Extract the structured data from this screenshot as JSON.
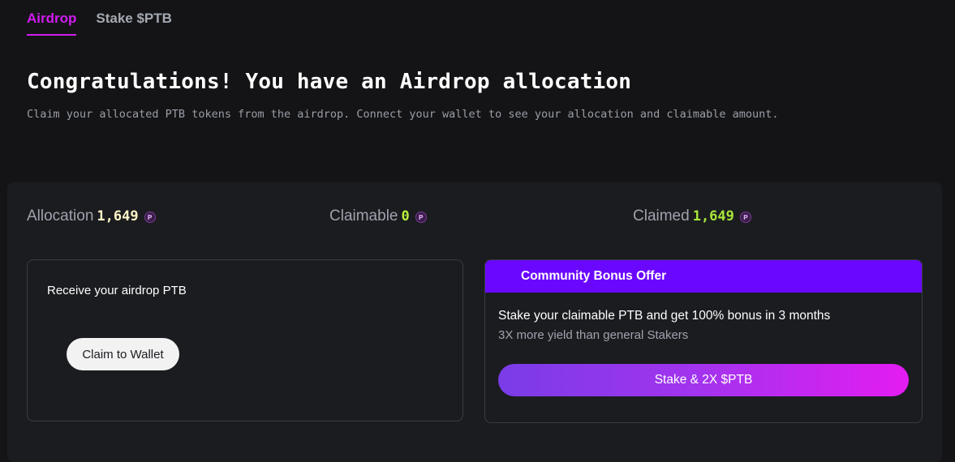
{
  "tabs": [
    {
      "label": "Airdrop",
      "active": true
    },
    {
      "label": "Stake $PTB",
      "active": false
    }
  ],
  "hero": {
    "title": "Congratulations! You have an Airdrop allocation",
    "subtitle": "Claim your allocated PTB tokens from the airdrop. Connect your wallet to see your allocation and claimable amount."
  },
  "stats": {
    "allocation": {
      "label": "Allocation",
      "value": "1,649",
      "color": "#fff5c8"
    },
    "claimable": {
      "label": "Claimable",
      "value": "0",
      "color": "#b6f03a"
    },
    "claimed": {
      "label": "Claimed",
      "value": "1,649",
      "color": "#a8e63a"
    },
    "token_icon": "ptb-token-icon",
    "token_glyph": "P"
  },
  "claim_card": {
    "label": "Receive your airdrop PTB",
    "button_label": "Claim to Wallet"
  },
  "bonus_card": {
    "header": "Community Bonus Offer",
    "line1": "Stake your claimable PTB and get 100% bonus in 3 months",
    "line2": "3X more yield than general Stakers",
    "button_label": "Stake & 2X $PTB"
  },
  "colors": {
    "accent": "#d21cf0",
    "bonus_header": "#6a08ff",
    "background": "#141416",
    "panel": "#1b1c20"
  }
}
